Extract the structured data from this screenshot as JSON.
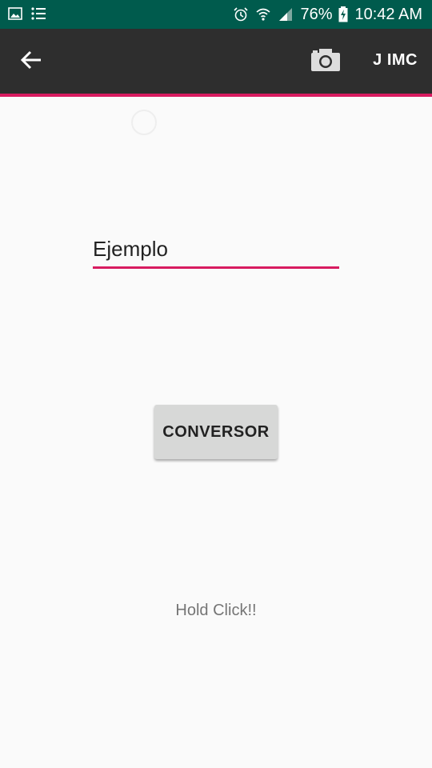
{
  "status_bar": {
    "battery": "76%",
    "time": "10:42 AM",
    "icons": [
      "image-icon",
      "list-icon",
      "alarm-icon",
      "wifi-icon",
      "signal-icon",
      "battery-charging-icon"
    ]
  },
  "app_bar": {
    "back_icon": "arrow-back-icon",
    "camera_icon": "camera-icon",
    "action_label": "J IMC",
    "accent_color": "#d81b60",
    "background_color": "#2e2e2e"
  },
  "form": {
    "input_value": "Ejemplo",
    "button_label": "CONVERSOR"
  },
  "footer": {
    "hint_text": "Hold Click!!"
  },
  "colors": {
    "status_bar": "#005b4d",
    "page_background": "#fafafa",
    "button_background": "#d7d8d7"
  }
}
